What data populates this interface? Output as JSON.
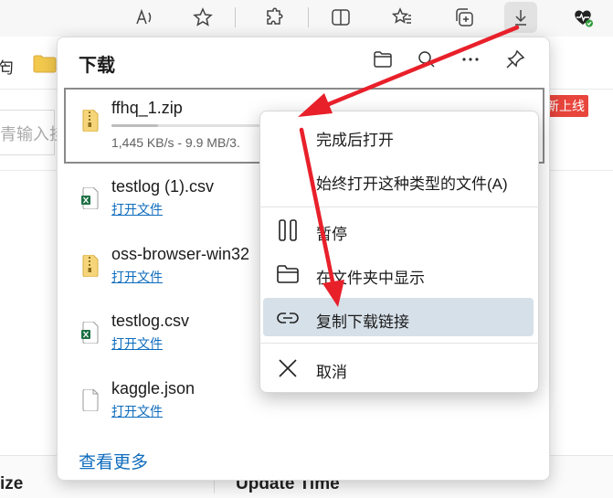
{
  "toolbar": {
    "icons": [
      "read-aloud-icon",
      "favorite-star-icon",
      "extensions-icon",
      "split-screen-icon",
      "favorites-list-icon",
      "collections-icon",
      "downloads-icon",
      "browser-essentials-icon"
    ]
  },
  "favorites_bar": {
    "partial_label": "匄"
  },
  "page": {
    "input_placeholder": "青输入挂",
    "new_badge": "新上线",
    "table_headers": {
      "size": "ize",
      "update_time": "Update Time"
    }
  },
  "downloads": {
    "title": "下载",
    "items": [
      {
        "name": "ffhq_1.zip",
        "type": "zip",
        "status": "1,445 KB/s - 9.9 MB/3.",
        "progress_percent": 30
      },
      {
        "name": "testlog (1).csv",
        "type": "excel",
        "action": "打开文件"
      },
      {
        "name": "oss-browser-win32",
        "type": "zip",
        "action": "打开文件"
      },
      {
        "name": "testlog.csv",
        "type": "excel",
        "action": "打开文件"
      },
      {
        "name": "kaggle.json",
        "type": "file",
        "action": "打开文件"
      }
    ],
    "see_more": "查看更多"
  },
  "context_menu": {
    "items": [
      {
        "label": "完成后打开"
      },
      {
        "label": "始终打开这种类型的文件(A)"
      },
      {
        "label": "暂停",
        "icon": "pause-icon"
      },
      {
        "label": "在文件夹中显示",
        "icon": "folder-icon"
      },
      {
        "label": "复制下载链接",
        "icon": "link-icon",
        "highlighted": true
      },
      {
        "label": "取消",
        "icon": "close-icon"
      }
    ]
  },
  "colors": {
    "link": "#0f6cbd",
    "highlight": "#d6e0e9",
    "annotation_arrow": "#e8202a",
    "badge": "#e8453c"
  }
}
